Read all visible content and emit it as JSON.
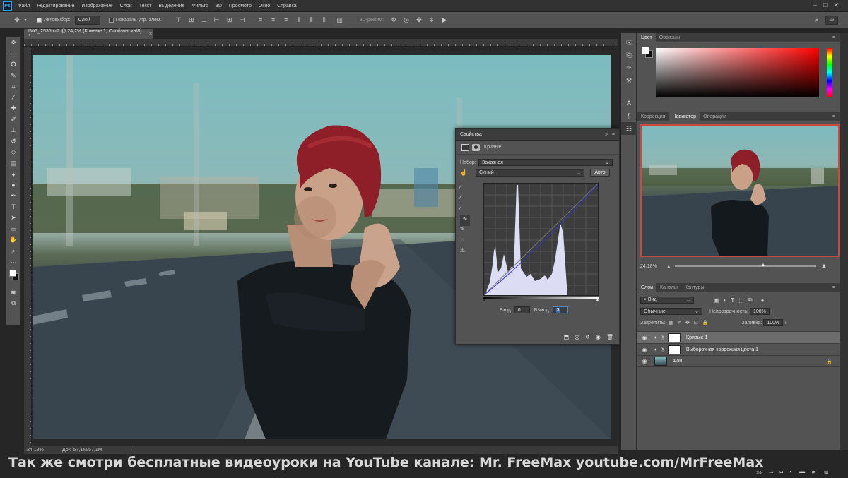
{
  "menubar": {
    "app_icon": "Ps",
    "items": [
      "Файл",
      "Редактирование",
      "Изображение",
      "Слои",
      "Текст",
      "Выделение",
      "Фильтр",
      "3D",
      "Просмотр",
      "Окно",
      "Справка"
    ]
  },
  "optionsbar": {
    "autoselect_label": "Автовыбор:",
    "autoselect_value": "Слой",
    "show_controls_label": "Показать упр. элем.",
    "mode3d_label": "3D-режим:"
  },
  "document": {
    "tab_title": "IMG_2536.cr2 @ 24,2% (Кривые 1, Слой-маска/8) *",
    "status_zoom": "24,18%",
    "status_doc": "Док: 57,1M/57,1M"
  },
  "properties": {
    "title": "Свойства",
    "curves_label": "Кривые",
    "preset_label": "Набор:",
    "preset_value": "Заказная",
    "channel_value": "Синий",
    "auto_button": "Авто",
    "input_label": "Вход:",
    "input_value": "0",
    "output_label": "Выход:",
    "output_value": "3"
  },
  "color_panel": {
    "tabs": [
      "Цвет",
      "Образцы"
    ],
    "hue_color": "#ff0000"
  },
  "navigator_panel": {
    "tabs": [
      "Коррекция",
      "Навигатор",
      "Операции"
    ],
    "zoom": "24,18%"
  },
  "layers_panel": {
    "tabs": [
      "Слои",
      "Каналы",
      "Контуры"
    ],
    "filter_value": "Вид",
    "blend_mode": "Обычные",
    "opacity_label": "Непрозрачность:",
    "opacity_value": "100%",
    "lock_label": "Закрепить:",
    "fill_label": "Заливка:",
    "fill_value": "100%",
    "layers": [
      {
        "name": "Кривые 1"
      },
      {
        "name": "Выборочная коррекция цвета 1"
      },
      {
        "name": "Фон"
      }
    ]
  },
  "caption": {
    "text": "Так же смотри бесплатные видеоуроки на YouTube канале: Mr. FreeMax youtube.com/MrFreeMax"
  }
}
